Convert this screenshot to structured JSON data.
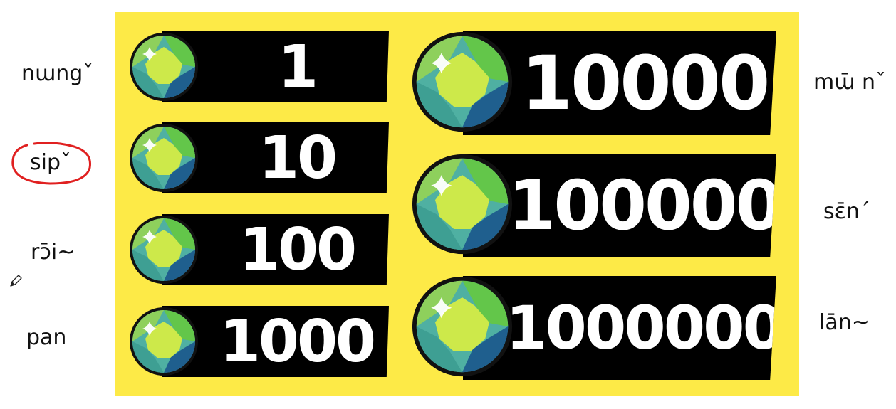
{
  "colors": {
    "panel": "#fdea47",
    "bar": "#000000",
    "number_text": "#ffffff",
    "circle_annotation": "#e02020"
  },
  "cards": [
    {
      "value": "1",
      "icon": "gem-icon"
    },
    {
      "value": "10",
      "icon": "gem-icon"
    },
    {
      "value": "100",
      "icon": "gem-icon"
    },
    {
      "value": "1000",
      "icon": "gem-icon"
    },
    {
      "value": "10000",
      "icon": "gem-icon"
    },
    {
      "value": "100000",
      "icon": "gem-icon"
    },
    {
      "value": "1000000",
      "icon": "gem-icon"
    }
  ],
  "left_words": [
    "nɯngˇ",
    "sipˇ",
    "rɔ̄i~",
    "pan"
  ],
  "right_words": [
    "mɯ̄ nˇ",
    "sɛ̄nˊ",
    "lān~"
  ],
  "annotations": {
    "circled_word_index": 1,
    "pen_cursor_icon": "pencil-icon"
  }
}
